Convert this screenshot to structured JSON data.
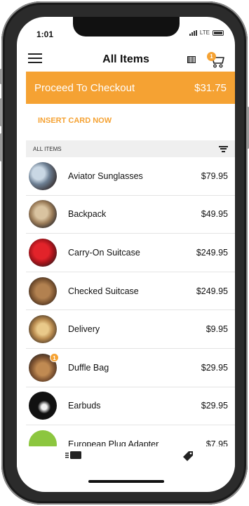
{
  "status": {
    "time": "1:01",
    "network": "LTE"
  },
  "header": {
    "title": "All Items",
    "cart_count": "1"
  },
  "checkout": {
    "label": "Proceed To Checkout",
    "total": "$31.75"
  },
  "insert_card": "INSERT CARD NOW",
  "section": {
    "label": "ALL ITEMS"
  },
  "colors": {
    "accent": "#f5a233"
  },
  "items": [
    {
      "name": "Aviator Sunglasses",
      "price": "$79.95",
      "badge": ""
    },
    {
      "name": "Backpack",
      "price": "$49.95",
      "badge": ""
    },
    {
      "name": "Carry-On Suitcase",
      "price": "$249.95",
      "badge": ""
    },
    {
      "name": "Checked Suitcase",
      "price": "$249.95",
      "badge": ""
    },
    {
      "name": "Delivery",
      "price": "$9.95",
      "badge": ""
    },
    {
      "name": "Duffle Bag",
      "price": "$29.95",
      "badge": "1"
    },
    {
      "name": "Earbuds",
      "price": "$29.95",
      "badge": ""
    },
    {
      "name": "European Plug Adapter",
      "price": "$7.95",
      "badge": ""
    }
  ],
  "tabbar": {
    "icons": [
      "scan-icon",
      "tag-icon"
    ]
  }
}
